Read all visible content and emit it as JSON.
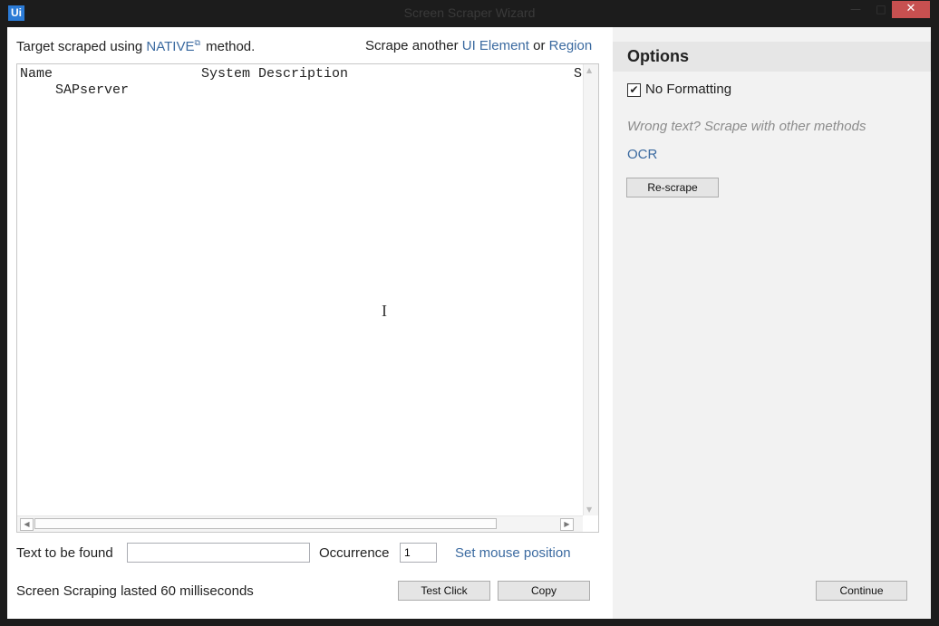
{
  "window": {
    "title": "Screen Scraper Wizard",
    "logo_text": "Ui",
    "minimize_glyph": "—",
    "maximize_glyph": "□",
    "close_glyph": "✕"
  },
  "main": {
    "target_prefix": "Target scraped using ",
    "method_link": "NATIVE",
    "method_suffix": " method.",
    "scrape_another_prefix": "Scrape another ",
    "ui_element_link": "UI Element",
    "or_text": " or ",
    "region_link": "Region",
    "scraped_text": {
      "header_name": "Name",
      "header_description": "System Description",
      "header_s": "S",
      "rows": [
        "SAPserver"
      ]
    },
    "find": {
      "label": "Text to be found",
      "value": "",
      "occurrence_label": "Occurrence",
      "occurrence_value": "1",
      "set_mouse_link": "Set mouse position"
    },
    "status_text": "Screen Scraping lasted 60 milliseconds",
    "test_click_label": "Test Click",
    "copy_label": "Copy"
  },
  "options": {
    "header": "Options",
    "no_formatting_label": "No Formatting",
    "no_formatting_checked": true,
    "hint": "Wrong text? Scrape with other methods",
    "ocr_link": "OCR",
    "rescrape_label": "Re-scrape",
    "continue_label": "Continue"
  },
  "colors": {
    "link": "#3b6aa0",
    "close_button": "#c75050",
    "logo": "#2b7bd6"
  }
}
